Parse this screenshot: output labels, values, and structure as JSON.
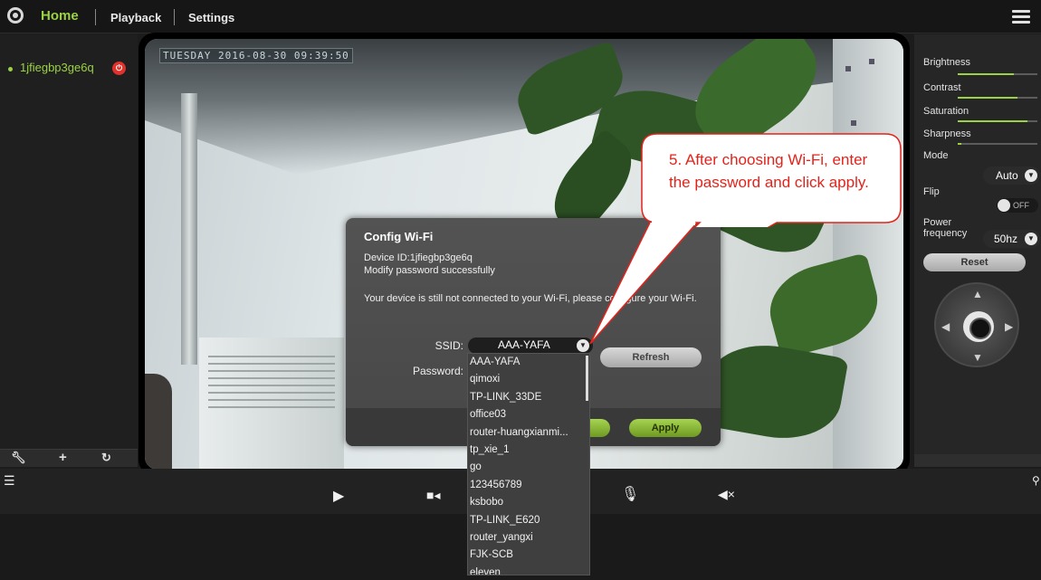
{
  "nav": {
    "home": "Home",
    "playback": "Playback",
    "settings": "Settings"
  },
  "device": {
    "name": "1jfiegbp3ge6q"
  },
  "video": {
    "timestamp": "TUESDAY 2016-08-30 09:39:50"
  },
  "adjust": {
    "brightness": {
      "label": "Brightness",
      "level": 0.7
    },
    "contrast": {
      "label": "Contrast",
      "level": 0.75
    },
    "saturation": {
      "label": "Saturation",
      "level": 0.88
    },
    "sharpness": {
      "label": "Sharpness",
      "level": 0.05
    },
    "mode_label": "Mode",
    "mode_value": "Auto",
    "flip_label": "Flip",
    "flip_state": "OFF",
    "power_label": "Power frequency",
    "power_value": "50hz",
    "reset": "Reset"
  },
  "dialog": {
    "title": "Config Wi-Fi",
    "device_id": "Device ID:1jfiegbp3ge6q",
    "status": "Modify password successfully",
    "message": "Your device is still not connected to your Wi-Fi, please configure your Wi-Fi.",
    "ssid_label": "SSID:",
    "ssid_value": "AAA-YAFA",
    "password_label": "Password:",
    "refresh": "Refresh",
    "apply": "Apply"
  },
  "ssid_options": [
    "AAA-YAFA",
    "qimoxi",
    "TP-LINK_33DE",
    "office03",
    "router-huangxianmi...",
    "tp_xie_1",
    "go",
    "123456789",
    "ksbobo",
    "TP-LINK_E620",
    "router_yangxi",
    "FJK-SCB",
    "eleven"
  ],
  "callout": {
    "text": "5. After choosing Wi-Fi, enter the password and click apply."
  },
  "colors": {
    "accent": "#9bd145",
    "callout_red": "#e3231b"
  }
}
